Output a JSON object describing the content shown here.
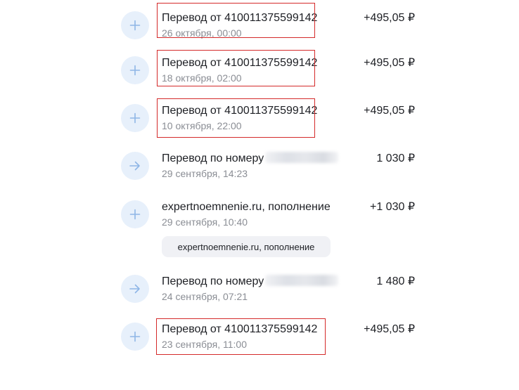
{
  "transactions": [
    {
      "title": "Перевод от 410011375599142",
      "date": "26 октября, 00:00",
      "amount": "+495,05 ₽",
      "icon": "plus-icon",
      "highlighted": true
    },
    {
      "title": "Перевод от 410011375599142",
      "date": "18 октября, 02:00",
      "amount": "+495,05 ₽",
      "icon": "plus-icon",
      "highlighted": true
    },
    {
      "title": "Перевод от 410011375599142",
      "date": "10 октября, 22:00",
      "amount": "+495,05 ₽",
      "icon": "plus-icon",
      "highlighted": true
    },
    {
      "title": "Перевод по номеру",
      "date": "29 сентября, 14:23",
      "amount": "1 030 ₽",
      "icon": "arrow-right-icon",
      "highlighted": false
    },
    {
      "title": "expertnoemnenie.ru, пополнение",
      "date": "29 сентября, 10:40",
      "amount": "+1 030 ₽",
      "icon": "plus-icon",
      "highlighted": false,
      "chip": "expertnoemnenie.ru, пополнение"
    },
    {
      "title": "Перевод по номеру",
      "date": "24 сентября, 07:21",
      "amount": "1 480 ₽",
      "icon": "arrow-right-icon",
      "highlighted": false
    },
    {
      "title": "Перевод от 410011375599142",
      "date": "23 сентября, 11:00",
      "amount": "+495,05 ₽",
      "icon": "plus-icon",
      "highlighted": true
    }
  ],
  "colors": {
    "icon_bg": "#e7f0fb",
    "icon_fg": "#8fb6e6",
    "highlight": "#d42a2a",
    "muted_text": "#8a8d94"
  }
}
